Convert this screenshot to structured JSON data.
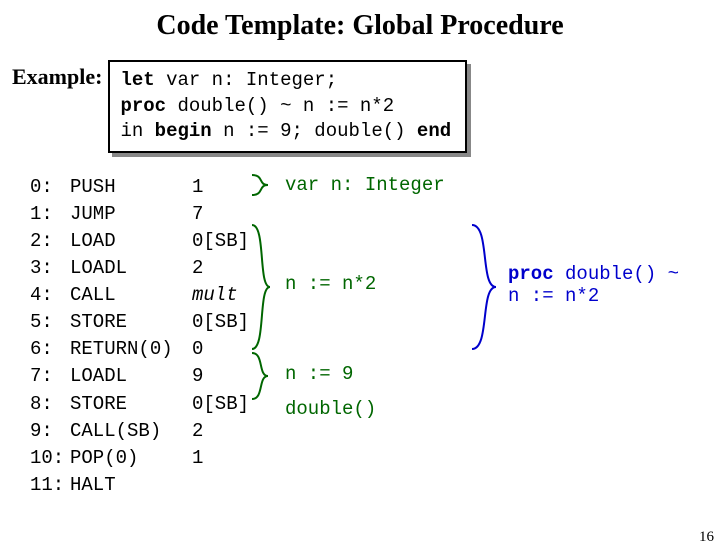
{
  "title": "Code Template: Global Procedure",
  "example_label": "Example:",
  "code_box": {
    "l1a": "let",
    "l1b": " var n: Integer;",
    "l2a": "    proc",
    "l2b": " double() ~ n := n*2",
    "l3a": "in ",
    "l3b": "begin",
    "l3c": " n := 9; double() ",
    "l3d": "end"
  },
  "instructions": [
    {
      "num": "0:",
      "op": "PUSH",
      "arg": "1",
      "it": false
    },
    {
      "num": "1:",
      "op": "JUMP",
      "arg": "7",
      "it": false
    },
    {
      "num": "2:",
      "op": "LOAD",
      "arg": "0[SB]",
      "it": false
    },
    {
      "num": "3:",
      "op": "LOADL",
      "arg": "2",
      "it": false
    },
    {
      "num": "4:",
      "op": "CALL",
      "arg": "mult",
      "it": true
    },
    {
      "num": "5:",
      "op": "STORE",
      "arg": "0[SB]",
      "it": false
    },
    {
      "num": "6:",
      "op": "RETURN(0)",
      "arg": "0",
      "it": false
    },
    {
      "num": "7:",
      "op": "LOADL",
      "arg": "9",
      "it": false
    },
    {
      "num": "8:",
      "op": "STORE",
      "arg": "0[SB]",
      "it": false
    },
    {
      "num": "9:",
      "op": "CALL(SB)",
      "arg": "2",
      "it": false
    },
    {
      "num": "10:",
      "op": "POP(0)",
      "arg": "1",
      "it": false
    },
    {
      "num": "11:",
      "op": "HALT",
      "arg": "",
      "it": false
    }
  ],
  "anno": {
    "var_decl": "var n: Integer",
    "n_eq_n2": "n := n*2",
    "proc_l1": "proc",
    "proc_l1b": " double() ~",
    "proc_l2": "  n := n*2",
    "n_eq_9": "n := 9",
    "dcall": "double()"
  },
  "page_number": "16"
}
